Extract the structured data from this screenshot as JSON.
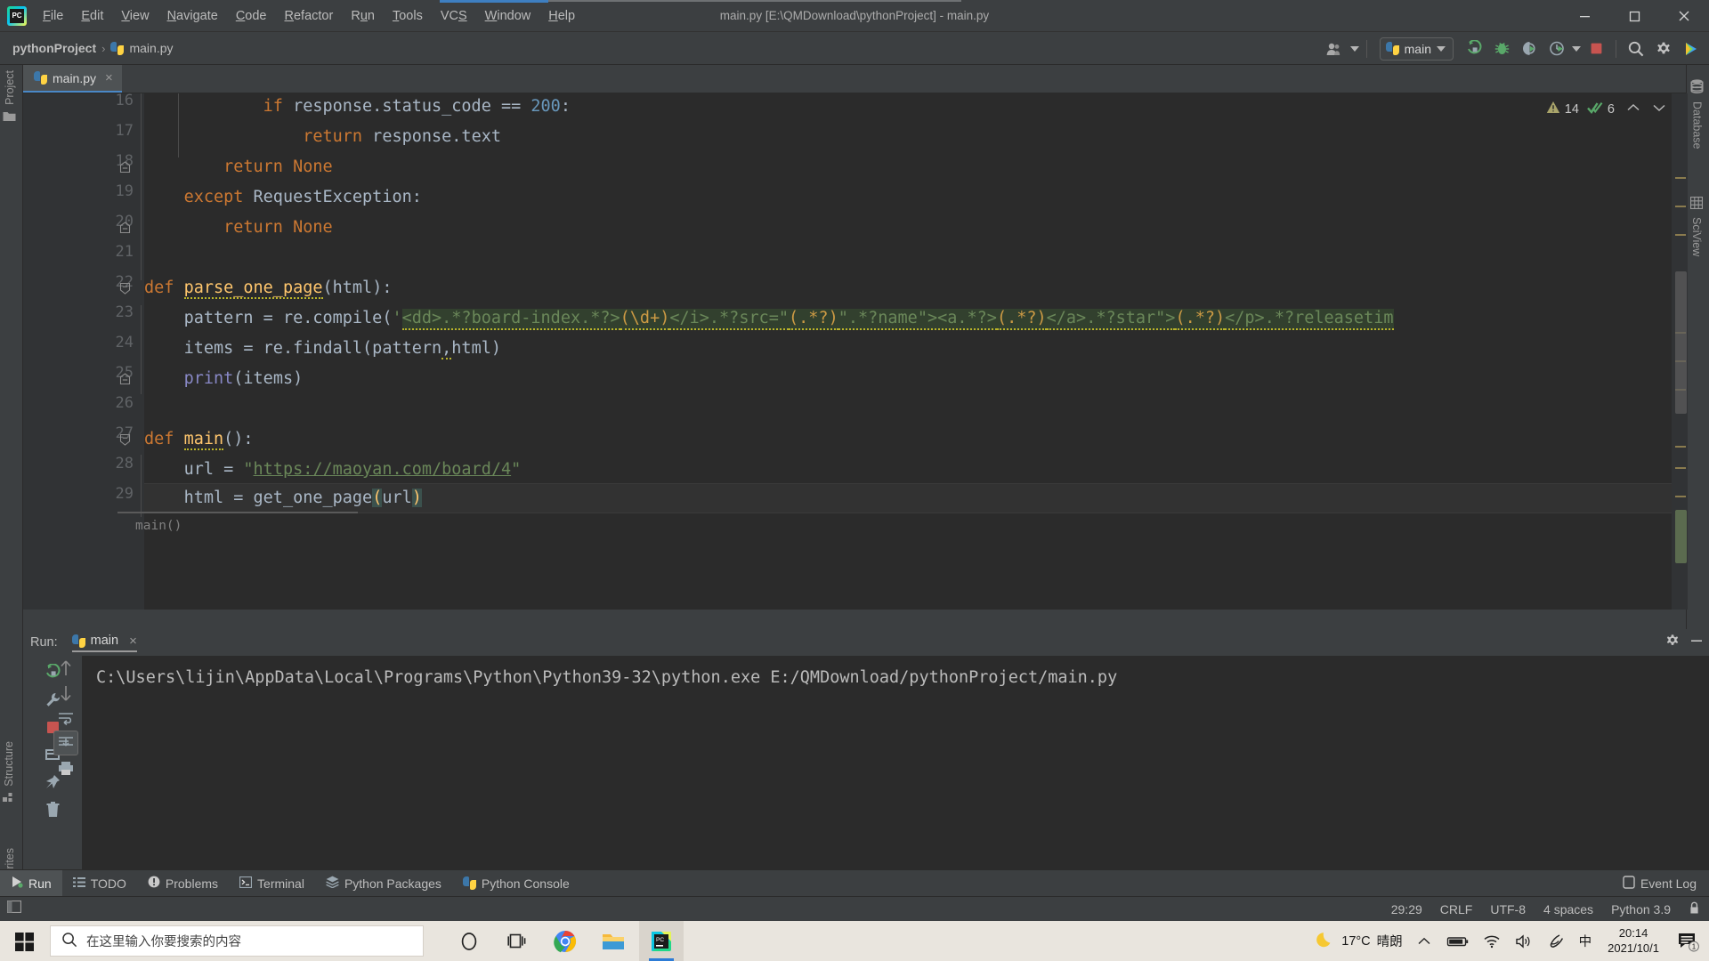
{
  "window": {
    "title": "main.py [E:\\QMDownload\\pythonProject] - main.py",
    "app_icon": "pycharm-logo-icon",
    "minimize": "minimize-icon",
    "maximize": "maximize-icon",
    "close": "close-icon"
  },
  "menu": [
    {
      "label": "File"
    },
    {
      "label": "Edit"
    },
    {
      "label": "View"
    },
    {
      "label": "Navigate"
    },
    {
      "label": "Code"
    },
    {
      "label": "Refactor"
    },
    {
      "label": "Run"
    },
    {
      "label": "Tools"
    },
    {
      "label": "VCS"
    },
    {
      "label": "Window"
    },
    {
      "label": "Help"
    }
  ],
  "breadcrumb": {
    "project": "pythonProject",
    "separator": "›",
    "file": "main.py"
  },
  "toolbar": {
    "account_icon": "user-account-icon",
    "run_config": "main",
    "run_icon": "run-icon",
    "debug_icon": "debug-bug-icon",
    "coverage_icon": "run-with-coverage-icon",
    "profile_icon": "profiler-icon",
    "stop_icon": "stop-icon",
    "search_icon": "search-everywhere-icon",
    "settings_icon": "settings-gear-icon",
    "updates_icon": "ide-updates-icon"
  },
  "editor_tabs": [
    {
      "label": "main.py",
      "icon": "python-file-icon",
      "close": "×",
      "active": true
    }
  ],
  "left_sidebar": [
    {
      "label": "Project",
      "icon": "project-folder-icon"
    }
  ],
  "right_sidebar": [
    {
      "label": "Database",
      "icon": "database-icon"
    },
    {
      "label": "SciView",
      "icon": "sciview-grid-icon"
    }
  ],
  "bottom_left_sidebar": [
    {
      "label": "Structure",
      "icon": "structure-icon"
    },
    {
      "label": "Favorites",
      "icon": "favorites-star-icon"
    }
  ],
  "inspections": {
    "warning_icon": "warning-triangle-icon",
    "warning_count": "14",
    "ok_icon": "inspection-ok-icon",
    "ok_count": "6",
    "prev_icon": "chevron-up-icon",
    "next_icon": "chevron-down-icon"
  },
  "code": {
    "lines": [
      {
        "no": "16",
        "text": "            if response.status_code == 200:"
      },
      {
        "no": "17",
        "text": "                return response.text"
      },
      {
        "no": "18",
        "text": "        return None"
      },
      {
        "no": "19",
        "text": "    except RequestException:"
      },
      {
        "no": "20",
        "text": "        return None"
      },
      {
        "no": "21",
        "text": ""
      },
      {
        "no": "22",
        "text": "def parse_one_page(html):"
      },
      {
        "no": "23",
        "text": "    pattern = re.compile('<dd>.*?board-index.*?>(\\d+)</i>.*?src=\"(.*?)\".*?name\"><a.*?>(.*?)</a>.*?star\">(.*?)</p>.*?releasetim"
      },
      {
        "no": "24",
        "text": "    items = re.findall(pattern,html)"
      },
      {
        "no": "25",
        "text": "    print(items)"
      },
      {
        "no": "26",
        "text": ""
      },
      {
        "no": "27",
        "text": "def main():"
      },
      {
        "no": "28",
        "text": "    url = \"https://maoyan.com/board/4\""
      },
      {
        "no": "29",
        "text": "    html = get_one_page(url)"
      }
    ],
    "inline_hint": "main()",
    "regex_literal": "<dd>.*?board-index.*?>(\\d+)</i>.*?src=\"(.*?)\".*?name\"><a.*?>(.*?)</a>.*?star\">(.*?)</p>.*?releasetim",
    "url_value": "https://maoyan.com/board/4"
  },
  "run_panel": {
    "label": "Run:",
    "tab": "main",
    "tab_icon": "python-run-icon",
    "close_icon": "×",
    "settings_icon": "settings-gear-icon",
    "minimize_icon": "minimize-panel-icon",
    "tools": [
      {
        "icon": "rerun-icon"
      },
      {
        "icon": "wrench-icon"
      },
      {
        "icon": "stop-red-icon"
      },
      {
        "icon": "print-grid-icon"
      },
      {
        "icon": "pin-icon"
      },
      {
        "icon": "trash-icon"
      }
    ],
    "tools_col2": [
      {
        "icon": "arrow-up-icon"
      },
      {
        "icon": "arrow-down-icon"
      },
      {
        "icon": "soft-wrap-icon"
      },
      {
        "icon": "scroll-end-icon"
      },
      {
        "icon": "print-icon"
      }
    ],
    "console_output": "C:\\Users\\lijin\\AppData\\Local\\Programs\\Python\\Python39-32\\python.exe E:/QMDownload/pythonProject/main.py"
  },
  "tool_tabs": [
    {
      "label": "Run",
      "icon": "run-green-icon",
      "active": true
    },
    {
      "label": "TODO",
      "icon": "todo-list-icon",
      "active": false
    },
    {
      "label": "Problems",
      "icon": "problems-icon",
      "active": false
    },
    {
      "label": "Terminal",
      "icon": "terminal-icon",
      "active": false
    },
    {
      "label": "Python Packages",
      "icon": "packages-icon",
      "active": false
    },
    {
      "label": "Python Console",
      "icon": "python-console-icon",
      "active": false
    }
  ],
  "event_log": {
    "label": "Event Log",
    "icon": "event-log-icon"
  },
  "status_bar": {
    "caret_position": "29:29",
    "line_separator": "CRLF",
    "encoding": "UTF-8",
    "indent": "4 spaces",
    "interpreter": "Python 3.9",
    "lock_icon": "read-only-lock-icon"
  },
  "taskbar": {
    "start_icon": "windows-start-icon",
    "search_placeholder": "在这里输入你要搜索的内容",
    "search_icon": "search-icon",
    "apps": [
      {
        "icon": "cortana-circle-icon",
        "name": "cortana"
      },
      {
        "icon": "task-view-icon",
        "name": "task-view"
      },
      {
        "icon": "chrome-icon",
        "name": "chrome"
      },
      {
        "icon": "file-explorer-icon",
        "name": "file-explorer"
      },
      {
        "icon": "pycharm-icon",
        "name": "pycharm"
      }
    ],
    "weather": {
      "icon": "moon-icon",
      "temp": "17°C",
      "desc": "晴朗"
    },
    "tray": [
      {
        "icon": "show-hidden-icons-icon"
      },
      {
        "icon": "battery-icon"
      },
      {
        "icon": "wifi-icon"
      },
      {
        "icon": "volume-icon"
      },
      {
        "icon": "ime-pen-icon"
      },
      {
        "icon": "ime-chinese-icon",
        "label": "中"
      }
    ],
    "clock": {
      "time": "20:14",
      "date": "2021/10/1"
    },
    "notifications": {
      "icon": "notification-icon",
      "count": "1"
    }
  },
  "colors": {
    "accent": "#4a88c7",
    "panel_bg": "#3c3f41",
    "editor_bg": "#2b2b2b",
    "keyword": "#cc7832",
    "string": "#6a8759",
    "number": "#6897bb",
    "function": "#ffc66d",
    "taskbar": "#e9e5de"
  }
}
